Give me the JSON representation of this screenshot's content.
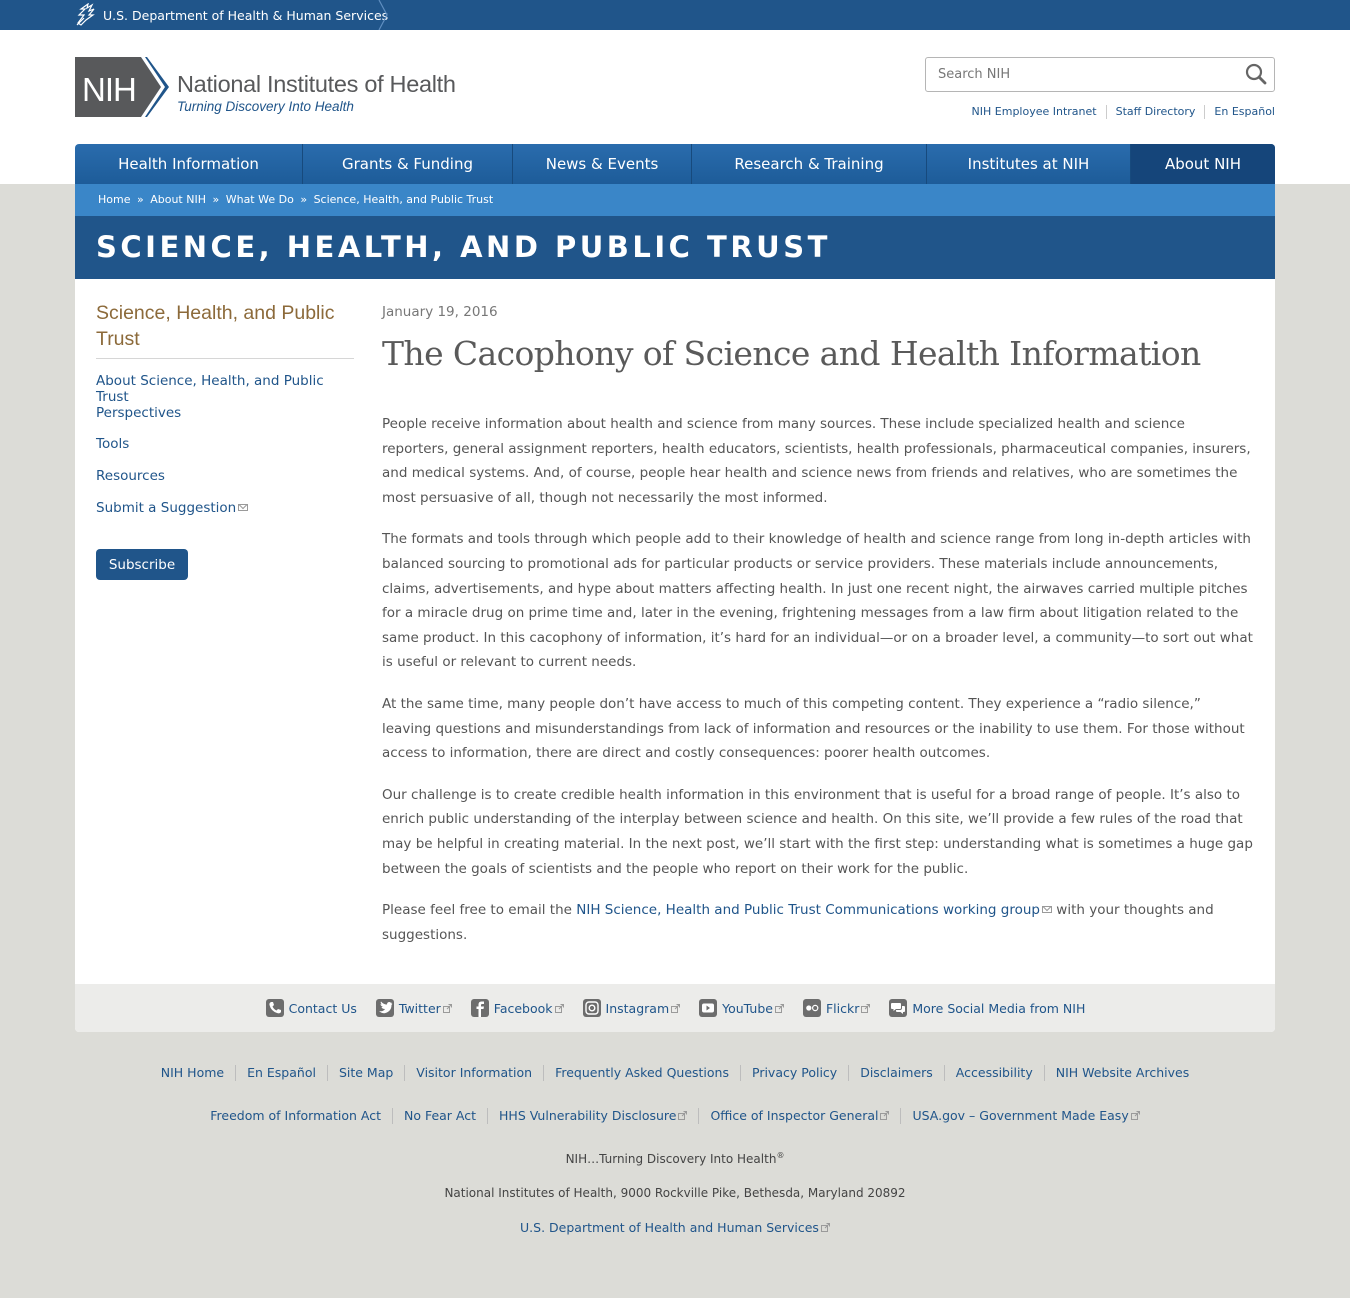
{
  "hhs_bar": {
    "label": "U.S. Department of Health & Human Services"
  },
  "logo": {
    "abbr": "NIH",
    "name": "National Institutes of Health",
    "tagline": "Turning Discovery Into Health"
  },
  "search": {
    "placeholder": "Search NIH"
  },
  "utility_links": [
    "NIH Employee Intranet",
    "Staff Directory",
    "En Español"
  ],
  "nav": [
    {
      "label": "Health Information"
    },
    {
      "label": "Grants & Funding"
    },
    {
      "label": "News & Events"
    },
    {
      "label": "Research & Training"
    },
    {
      "label": "Institutes at NIH"
    },
    {
      "label": "About NIH",
      "active": true
    }
  ],
  "breadcrumb": [
    "Home",
    "About NIH",
    "What We Do",
    "Science, Health, and Public Trust"
  ],
  "breadcrumb_sep": "»",
  "page_title": "SCIENCE, HEALTH, AND PUBLIC TRUST",
  "sidebar": {
    "heading": "Science, Health, and Public Trust",
    "items": [
      "About Science, Health, and Public Trust",
      "Perspectives",
      "Tools",
      "Resources",
      "Submit a Suggestion"
    ],
    "subscribe": "Subscribe"
  },
  "article": {
    "date": "January 19, 2016",
    "title": "The Cacophony of Science and Health Information",
    "paragraphs": [
      "People receive information about health and science from many sources. These include specialized health and science reporters, general assignment reporters, health educators, scientists, health professionals, pharmaceutical companies, insurers, and medical systems. And, of course, people hear health and science news from friends and relatives, who are sometimes the most persuasive of all, though not necessarily the most informed.",
      "The formats and tools through which people add to their knowledge of health and science range from long in-depth articles with balanced sourcing to promotional ads for particular products or service providers. These materials include announcements, claims, advertisements, and hype about matters affecting health. In just one recent night, the airwaves carried multiple pitches for a miracle drug on prime time and, later in the evening, frightening messages from a law firm about litigation related to the same product. In this cacophony of information, it’s hard for an individual—or on a broader level, a community—to sort out what is useful or relevant to current needs.",
      "At the same time, many people don’t have access to much of this competing content. They experience a “radio silence,” leaving questions and misunderstandings from lack of information and resources or the inability to use them. For those without access to information, there are direct and costly consequences: poorer health outcomes.",
      "Our challenge is to create credible health information in this environment that is useful for a broad range of people. It’s also to enrich public understanding of the interplay between science and health. On this site, we’ll provide a few rules of the road that may be helpful in creating material. In the next post, we’ll start with the first step: understanding what is sometimes a huge gap between the goals of scientists and the people who report on their work for the public."
    ],
    "closing_before": "Please feel free to email the ",
    "closing_link": "NIH Science, Health and Public Trust Communications working group",
    "closing_after": " with your thoughts and suggestions."
  },
  "social": [
    {
      "label": "Contact Us",
      "icon": "phone-icon",
      "external": false
    },
    {
      "label": "Twitter",
      "icon": "twitter-icon",
      "external": true
    },
    {
      "label": "Facebook",
      "icon": "facebook-icon",
      "external": true
    },
    {
      "label": "Instagram",
      "icon": "instagram-icon",
      "external": true
    },
    {
      "label": "YouTube",
      "icon": "youtube-icon",
      "external": true
    },
    {
      "label": "Flickr",
      "icon": "flickr-icon",
      "external": true
    },
    {
      "label": "More Social Media from NIH",
      "icon": "chat-icon",
      "external": false
    }
  ],
  "footer": {
    "row1": [
      "NIH Home",
      "En Español",
      "Site Map",
      "Visitor Information",
      "Frequently Asked Questions",
      "Privacy Policy",
      "Disclaimers",
      "Accessibility",
      "NIH Website Archives"
    ],
    "row2": [
      "Freedom of Information Act",
      "No Fear Act",
      "HHS Vulnerability Disclosure",
      "Office of Inspector General",
      "USA.gov – Government Made Easy"
    ],
    "tagline": "NIH…Turning Discovery Into Health",
    "tagline_mark": "®",
    "address": "National Institutes of Health, 9000 Rockville Pike, Bethesda, Maryland 20892",
    "hhs_link": "U.S. Department of Health and Human Services"
  },
  "colors": {
    "primary": "#20558a",
    "breadcrumb": "#3a86c8",
    "sidebar_heading": "#8c6a3a",
    "background": "#dcdcd7"
  }
}
